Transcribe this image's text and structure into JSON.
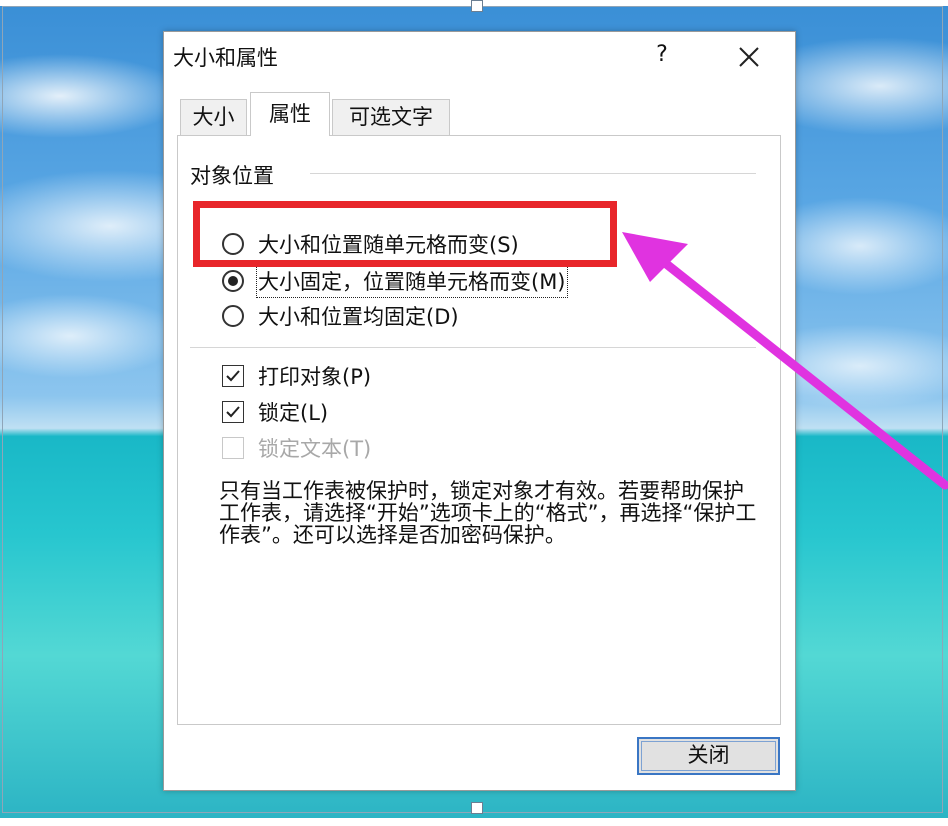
{
  "dialog": {
    "title": "大小和属性",
    "help_label": "?",
    "close_button_label": "关闭"
  },
  "tabs": [
    {
      "label": "大小",
      "active": false
    },
    {
      "label": "属性",
      "active": true
    },
    {
      "label": "可选文字",
      "active": false
    }
  ],
  "object_position": {
    "group_label": "对象位置",
    "options": [
      {
        "label": "大小和位置随单元格而变(S)",
        "selected": false
      },
      {
        "label": "大小固定，位置随单元格而变(M)",
        "selected": true
      },
      {
        "label": "大小和位置均固定(D)",
        "selected": false
      }
    ]
  },
  "checkboxes": [
    {
      "label": "打印对象(P)",
      "checked": true,
      "enabled": true
    },
    {
      "label": "锁定(L)",
      "checked": true,
      "enabled": true
    },
    {
      "label": "锁定文本(T)",
      "checked": false,
      "enabled": false
    }
  ],
  "description": "只有当工作表被保护时，锁定对象才有效。若要帮助保护工作表，请选择“开始”选项卡上的“格式”，再选择“保护工作表”。还可以选择是否加密码保护。",
  "annotation": {
    "highlight_color": "#e8262a",
    "arrow_color": "#e033e0"
  }
}
